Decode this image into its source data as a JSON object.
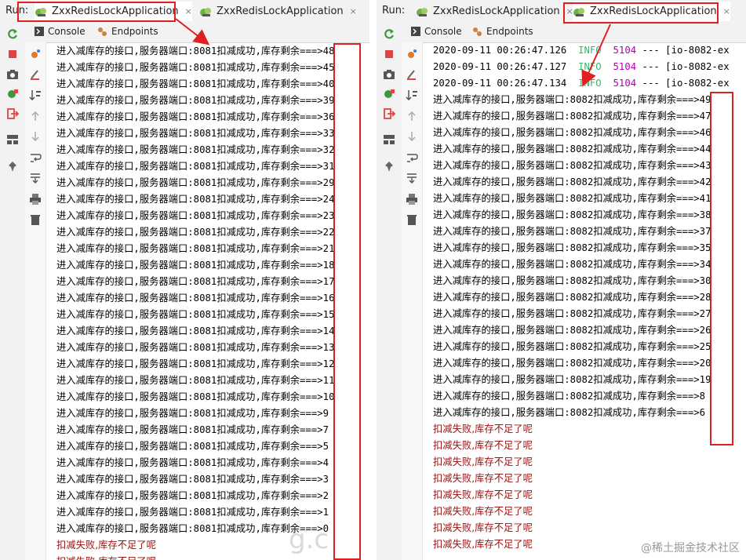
{
  "left": {
    "run_label": "Run:",
    "tabs": [
      {
        "label": "ZxxRedisLockApplication",
        "close": "×"
      },
      {
        "label": "ZxxRedisLockApplication",
        "close": "×"
      }
    ],
    "subtabs": [
      "Console",
      "Endpoints"
    ],
    "lines": [
      "进入减库存的接口,服务器端口:8081扣减成功,库存剩余===>48",
      "进入减库存的接口,服务器端口:8081扣减成功,库存剩余===>45",
      "进入减库存的接口,服务器端口:8081扣减成功,库存剩余===>40",
      "进入减库存的接口,服务器端口:8081扣减成功,库存剩余===>39",
      "进入减库存的接口,服务器端口:8081扣减成功,库存剩余===>36",
      "进入减库存的接口,服务器端口:8081扣减成功,库存剩余===>33",
      "进入减库存的接口,服务器端口:8081扣减成功,库存剩余===>32",
      "进入减库存的接口,服务器端口:8081扣减成功,库存剩余===>31",
      "进入减库存的接口,服务器端口:8081扣减成功,库存剩余===>29",
      "进入减库存的接口,服务器端口:8081扣减成功,库存剩余===>24",
      "进入减库存的接口,服务器端口:8081扣减成功,库存剩余===>23",
      "进入减库存的接口,服务器端口:8081扣减成功,库存剩余===>22",
      "进入减库存的接口,服务器端口:8081扣减成功,库存剩余===>21",
      "进入减库存的接口,服务器端口:8081扣减成功,库存剩余===>18",
      "进入减库存的接口,服务器端口:8081扣减成功,库存剩余===>17",
      "进入减库存的接口,服务器端口:8081扣减成功,库存剩余===>16",
      "进入减库存的接口,服务器端口:8081扣减成功,库存剩余===>15",
      "进入减库存的接口,服务器端口:8081扣减成功,库存剩余===>14",
      "进入减库存的接口,服务器端口:8081扣减成功,库存剩余===>13",
      "进入减库存的接口,服务器端口:8081扣减成功,库存剩余===>12",
      "进入减库存的接口,服务器端口:8081扣减成功,库存剩余===>11",
      "进入减库存的接口,服务器端口:8081扣减成功,库存剩余===>10",
      "进入减库存的接口,服务器端口:8081扣减成功,库存剩余===>9",
      "进入减库存的接口,服务器端口:8081扣减成功,库存剩余===>7",
      "进入减库存的接口,服务器端口:8081扣减成功,库存剩余===>5",
      "进入减库存的接口,服务器端口:8081扣减成功,库存剩余===>4",
      "进入减库存的接口,服务器端口:8081扣减成功,库存剩余===>3",
      "进入减库存的接口,服务器端口:8081扣减成功,库存剩余===>2",
      "进入减库存的接口,服务器端口:8081扣减成功,库存剩余===>1",
      "进入减库存的接口,服务器端口:8081扣减成功,库存剩余===>0"
    ],
    "errors": [
      "扣减失败,库存不足了呢",
      "扣减失败,库存不足了呢"
    ]
  },
  "right": {
    "run_label": "Run:",
    "tabs": [
      {
        "label": "ZxxRedisLockApplication",
        "close": "×"
      },
      {
        "label": "ZxxRedisLockApplication",
        "close": "×"
      }
    ],
    "subtabs": [
      "Console",
      "Endpoints"
    ],
    "log_lines": [
      {
        "ts": "2020-09-11 00:26:47.126",
        "level": "INFO",
        "pid": "5104",
        "rest": " --- [io-8082-ex"
      },
      {
        "ts": "2020-09-11 00:26:47.127",
        "level": "INFO",
        "pid": "5104",
        "rest": " --- [io-8082-ex"
      },
      {
        "ts": "2020-09-11 00:26:47.134",
        "level": "INFO",
        "pid": "5104",
        "rest": " --- [io-8082-ex"
      }
    ],
    "lines": [
      "进入减库存的接口,服务器端口:8082扣减成功,库存剩余===>49",
      "进入减库存的接口,服务器端口:8082扣减成功,库存剩余===>47",
      "进入减库存的接口,服务器端口:8082扣减成功,库存剩余===>46",
      "进入减库存的接口,服务器端口:8082扣减成功,库存剩余===>44",
      "进入减库存的接口,服务器端口:8082扣减成功,库存剩余===>43",
      "进入减库存的接口,服务器端口:8082扣减成功,库存剩余===>42",
      "进入减库存的接口,服务器端口:8082扣减成功,库存剩余===>41",
      "进入减库存的接口,服务器端口:8082扣减成功,库存剩余===>38",
      "进入减库存的接口,服务器端口:8082扣减成功,库存剩余===>37",
      "进入减库存的接口,服务器端口:8082扣减成功,库存剩余===>35",
      "进入减库存的接口,服务器端口:8082扣减成功,库存剩余===>34",
      "进入减库存的接口,服务器端口:8082扣减成功,库存剩余===>30",
      "进入减库存的接口,服务器端口:8082扣减成功,库存剩余===>28",
      "进入减库存的接口,服务器端口:8082扣减成功,库存剩余===>27",
      "进入减库存的接口,服务器端口:8082扣减成功,库存剩余===>26",
      "进入减库存的接口,服务器端口:8082扣减成功,库存剩余===>25",
      "进入减库存的接口,服务器端口:8082扣减成功,库存剩余===>20",
      "进入减库存的接口,服务器端口:8082扣减成功,库存剩余===>19",
      "进入减库存的接口,服务器端口:8082扣减成功,库存剩余===>8",
      "进入减库存的接口,服务器端口:8082扣减成功,库存剩余===>6"
    ],
    "errors": [
      "扣减失败,库存不足了呢",
      "扣减失败,库存不足了呢",
      "扣减失败,库存不足了呢",
      "扣减失败,库存不足了呢",
      "扣减失败,库存不足了呢",
      "扣减失败,库存不足了呢",
      "扣减失败,库存不足了呢",
      "扣减失败,库存不足了呢"
    ]
  },
  "watermark": {
    "text": "g.c",
    "juejin": "@稀土掘金技术社区"
  },
  "colors": {
    "highlight": "#e02020",
    "info": "#3cb371",
    "pid": "#b000b0",
    "error": "#9b1010"
  }
}
